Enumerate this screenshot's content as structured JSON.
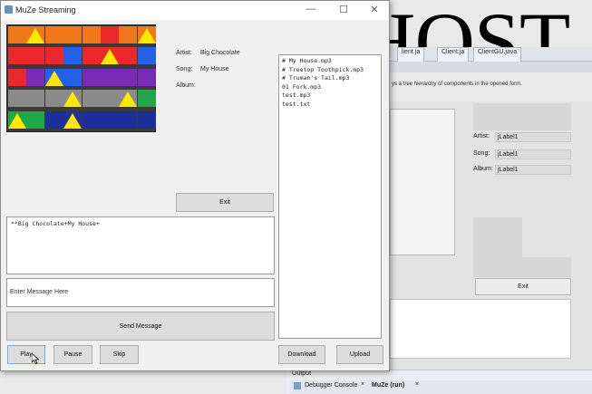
{
  "overlay": {
    "text": "HOST"
  },
  "ide": {
    "tabs": [
      "lient.ja",
      "Client.ja",
      "ClientGU.java"
    ],
    "hint": "ys a tree hierarchy of components in the opened form.",
    "artist_label": "Artist:",
    "artist_value": "jLabel1",
    "song_label": "Song:",
    "song_value": "jLabel1",
    "album_label": "Album:",
    "album_value": "jLabel1",
    "exit_label": "Exit",
    "output_label": "Output",
    "debugger_tab": "Debugger Console",
    "run_tab": "MuZe (run)",
    "close_glyph": "×"
  },
  "window": {
    "title": "MuZe Streaming",
    "minimize": "—",
    "maximize": "☐",
    "close": "✕"
  },
  "info": {
    "artist_label": "Artist:",
    "artist_value": "Big Chocolate",
    "song_label": "Song:",
    "song_value": "My House",
    "album_label": "Album:",
    "album_value": ""
  },
  "playlist": [
    "# My House.mp3",
    "# Treetop Toothpick.mp3",
    "# Truman's Tail.mp3",
    "01 Fork.mp3",
    "test.mp3",
    "test.txt"
  ],
  "chat": {
    "log": "**Big Chocolate+My House+",
    "input_value": "Enter Message Here",
    "send_label": "Send Message"
  },
  "buttons": {
    "exit": "Exit",
    "play": "Play",
    "pause": "Pause",
    "skip": "Skip",
    "download": "Download",
    "upload": "Upload"
  },
  "colors": {
    "tile_orange": "#f07818",
    "tile_red": "#e8282a",
    "tile_blue": "#2460e8",
    "tile_purple": "#7a2ab8",
    "tile_gray": "#8a8a8a",
    "tile_green": "#20a848",
    "tile_navy": "#1d2f9a",
    "triangle": "#ffe800",
    "art_bg": "#3a3a3a"
  }
}
